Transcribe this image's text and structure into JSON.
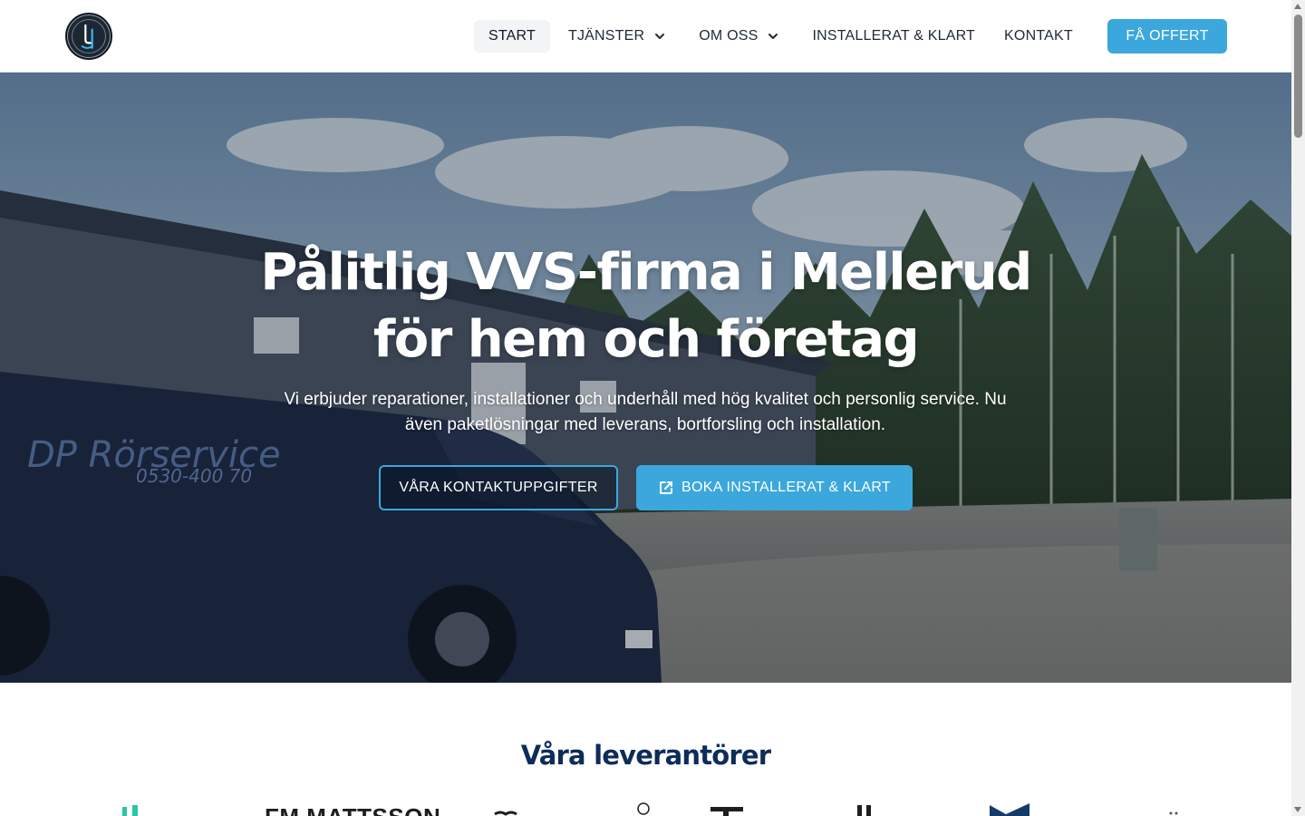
{
  "nav": {
    "items": [
      {
        "label": "START",
        "active": true,
        "dropdown": false
      },
      {
        "label": "TJÄNSTER",
        "active": false,
        "dropdown": true
      },
      {
        "label": "OM OSS",
        "active": false,
        "dropdown": true
      },
      {
        "label": "INSTALLERAT & KLART",
        "active": false,
        "dropdown": false
      },
      {
        "label": "KONTAKT",
        "active": false,
        "dropdown": false
      }
    ],
    "cta_label": "FÅ OFFERT"
  },
  "hero": {
    "title_line1": "Pålitlig VVS-firma i Mellerud",
    "title_line2": "för hem och företag",
    "subtitle": "Vi erbjuder reparationer, installationer och underhåll med hög kvalitet och personlig service. Nu även paketlösningar med leverans, bortforsling och installation.",
    "contact_button_label": "VÅRA KONTAKTUPPGIFTER",
    "book_button_label": "BOKA INSTALLERAT & KLART",
    "van_text": "DP Rörservice",
    "van_phone": "0530-400 70"
  },
  "suppliers": {
    "title": "Våra leverantörer",
    "visible_logo_text": "FM MATTSSON"
  },
  "colors": {
    "accent": "#3ba7dd",
    "heading_navy": "#0d2c5a",
    "nav_active_bg": "#f3f4f6"
  },
  "icons": {
    "chevron": "chevron-down-icon",
    "external": "external-link-icon"
  }
}
